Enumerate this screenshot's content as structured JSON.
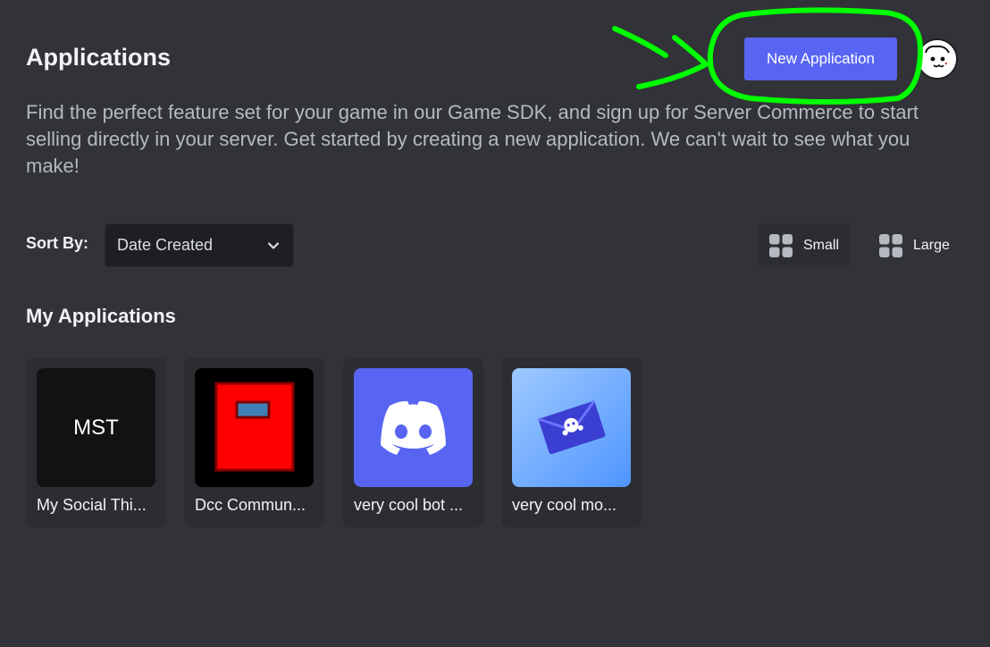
{
  "header": {
    "title": "Applications",
    "new_app_label": "New Application",
    "description": "Find the perfect feature set for your game in our Game SDK, and sign up for Server Commerce to start selling directly in your server. Get started by creating a new application. We can't wait to see what you make!"
  },
  "sort": {
    "label": "Sort By:",
    "value": "Date Created"
  },
  "view": {
    "small_label": "Small",
    "large_label": "Large"
  },
  "section": {
    "title": "My Applications"
  },
  "apps": [
    {
      "name": "My Social Thi...",
      "icon_text": "MST",
      "icon": "mst-text-icon"
    },
    {
      "name": "Dcc Commun...",
      "icon": "red-notebook-icon"
    },
    {
      "name": "very cool bot ...",
      "icon": "discord-logo-icon"
    },
    {
      "name": "very cool mo...",
      "icon": "envelope-icon"
    }
  ],
  "colors": {
    "brand": "#5865f2",
    "background": "#313338",
    "card": "#2b2d31",
    "annotation": "#00ff00"
  }
}
